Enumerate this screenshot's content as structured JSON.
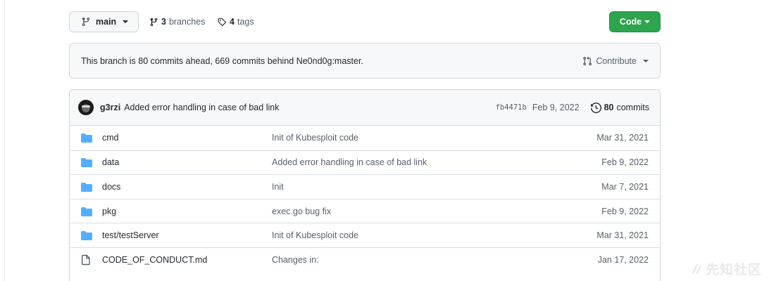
{
  "topbar": {
    "branch": "main",
    "branches_count": "3",
    "branches_label": "branches",
    "tags_count": "4",
    "tags_label": "tags",
    "code_label": "Code"
  },
  "banner": {
    "text": "This branch is 80 commits ahead, 669 commits behind Ne0nd0g:master.",
    "contribute_label": "Contribute"
  },
  "latest_commit": {
    "author": "g3rzi",
    "message": "Added error handling in case of bad link",
    "sha": "fb4471b",
    "date": "Feb 9, 2022",
    "commits_count": "80",
    "commits_label": "commits"
  },
  "files": [
    {
      "type": "folder",
      "name": "cmd",
      "message": "Init of Kubesploit code",
      "date": "Mar 31, 2021"
    },
    {
      "type": "folder",
      "name": "data",
      "message": "Added error handling in case of bad link",
      "date": "Feb 9, 2022"
    },
    {
      "type": "folder",
      "name": "docs",
      "message": "Init",
      "date": "Mar 7, 2021"
    },
    {
      "type": "folder",
      "name": "pkg",
      "message": "exec.go bug fix",
      "date": "Feb 9, 2022"
    },
    {
      "type": "folder",
      "name": "test/testServer",
      "message": "Init of Kubesploit code",
      "date": "Mar 31, 2021"
    },
    {
      "type": "file",
      "name": "CODE_OF_CONDUCT.md",
      "message": "Changes in:",
      "date": "Jan 17, 2022"
    }
  ],
  "colors": {
    "folder": "#54aeff",
    "code_button": "#2da44e"
  },
  "watermark": "先知社区"
}
